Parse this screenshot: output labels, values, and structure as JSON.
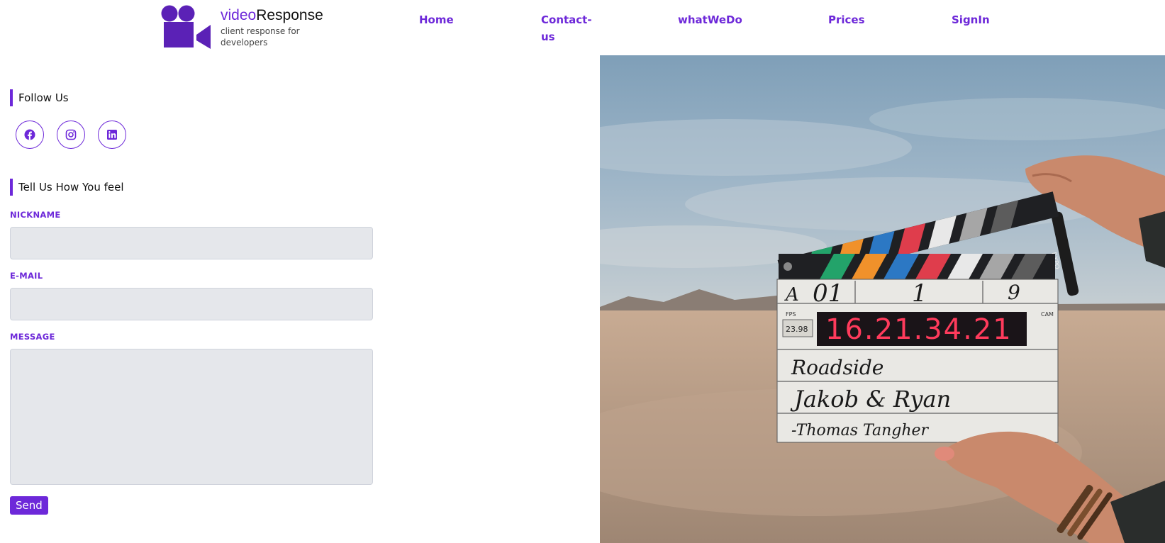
{
  "header": {
    "brand_part1": "video",
    "brand_part2": "Response",
    "tagline": "client response for developers",
    "logo_icon": "video-camera-icon"
  },
  "nav": {
    "items": [
      {
        "label": "Home"
      },
      {
        "label": "Contact-us"
      },
      {
        "label": "whatWeDo"
      },
      {
        "label": "Prices"
      },
      {
        "label": "SignIn"
      }
    ]
  },
  "follow": {
    "title": "Follow Us",
    "icons": [
      "facebook-icon",
      "instagram-icon",
      "linkedin-icon"
    ]
  },
  "form": {
    "title": "Tell Us How You feel",
    "nickname_label": "NICKNAME",
    "nickname_value": "",
    "email_label": "E-MAIL",
    "email_value": "",
    "message_label": "MESSAGE",
    "message_value": "",
    "send_label": "Send"
  },
  "hero": {
    "slate_a": "A",
    "slate_roll": "01",
    "slate_scene": "1",
    "slate_take": "9",
    "fps_label": "FPS",
    "fps_value": "23.98",
    "cam_label": "CAM",
    "timecode": "16.21.34.21",
    "production": "Roadside",
    "director": "Jakob & Ryan",
    "camera_op": "-Thomas Tangher",
    "marker_text": "EXPO"
  },
  "colors": {
    "accent": "#6d28d9",
    "field_bg": "#e5e7eb",
    "timecode_red": "#ff3b5c"
  }
}
